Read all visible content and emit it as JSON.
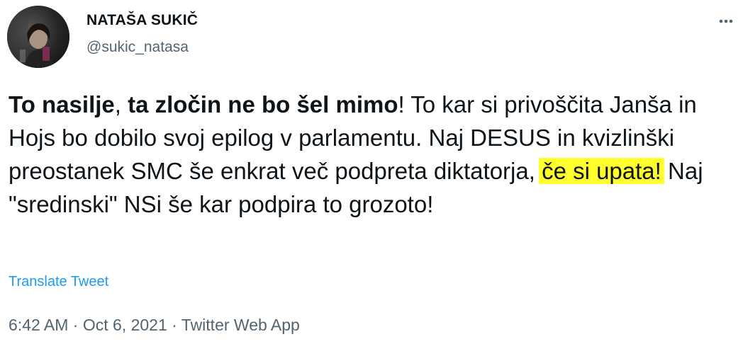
{
  "author": {
    "name": "NATAŠA SUKIČ",
    "handle": "@sukic_natasa"
  },
  "more_icon": "more-horizontal-icon",
  "tweet": {
    "bold_1": "To nasilje",
    "sep_1": ", ",
    "bold_2": "ta zločin ne bo šel mimo",
    "text_1": "! To kar si privoščita Janša in Hojs bo dobilo svoj epilog v parlamentu. Naj DESUS in kvizlinški preostanek SMC še enkrat več podpreta diktatorja, ",
    "highlighted": "če si upata!",
    "text_2": " Naj \"sredinski\" NSi še kar podpira to grozoto!",
    "highlight_color": "#ffff2e"
  },
  "translate_label": "Translate Tweet",
  "meta": {
    "time": "6:42 AM",
    "dot_1": " · ",
    "date": "Oct 6, 2021",
    "dot_2": " · ",
    "source": "Twitter Web App"
  },
  "colors": {
    "text": "#0f1419",
    "secondary": "#536471",
    "link": "#1d9bf0"
  }
}
